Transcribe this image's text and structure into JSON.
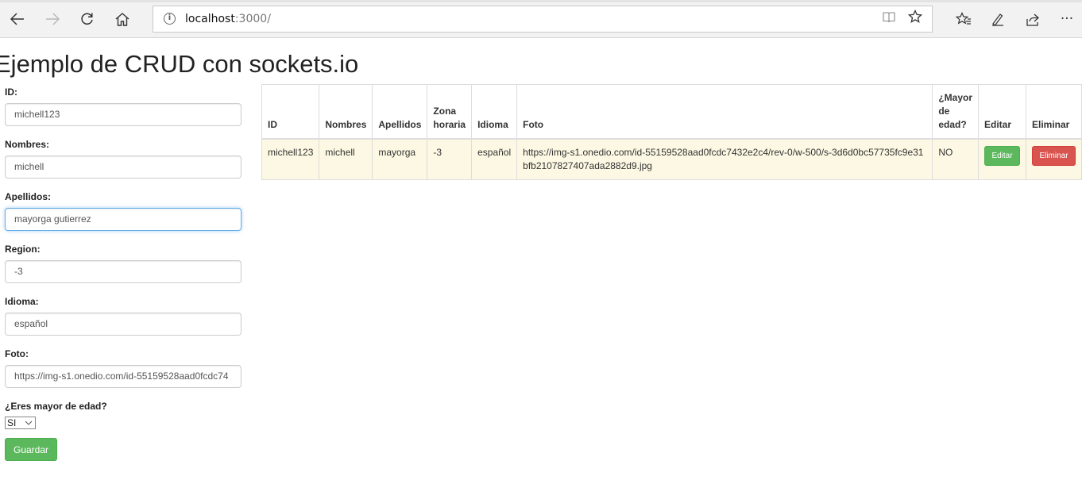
{
  "browser": {
    "url_host": "localhost",
    "url_path": ":3000/",
    "icons": {
      "back": "back-arrow-icon",
      "forward": "forward-arrow-icon",
      "refresh": "refresh-icon",
      "home": "home-icon",
      "info": "info-icon",
      "reading": "reading-view-icon",
      "favorite": "star-icon",
      "favorites_list": "favorites-list-icon",
      "pen": "pen-icon",
      "share": "share-icon",
      "more": "more-icon"
    }
  },
  "page": {
    "title": "Ejemplo de CRUD con sockets.io"
  },
  "form": {
    "id_label": "ID:",
    "id_value": "michell123",
    "nombres_label": "Nombres:",
    "nombres_value": "michell",
    "apellidos_label": "Apellidos:",
    "apellidos_value": "mayorga gutierrez",
    "region_label": "Region:",
    "region_value": "-3",
    "idioma_label": "Idioma:",
    "idioma_value": "español",
    "foto_label": "Foto:",
    "foto_value": "https://img-s1.onedio.com/id-55159528aad0fcdc74",
    "mayor_label": "¿Eres mayor de edad?",
    "mayor_value": "SI",
    "save_label": "Guardar"
  },
  "table": {
    "headers": {
      "id": "ID",
      "nombres": "Nombres",
      "apellidos": "Apellidos",
      "zona": "Zona horaria",
      "idioma": "Idioma",
      "foto": "Foto",
      "mayor": "¿Mayor de edad?",
      "editar": "Editar",
      "eliminar": "Eliminar"
    },
    "rows": [
      {
        "id": "michell123",
        "nombres": "michell",
        "apellidos": "mayorga",
        "zona": "-3",
        "idioma": "español",
        "foto": "https://img-s1.onedio.com/id-55159528aad0fcdc7432e2c4/rev-0/w-500/s-3d6d0bc57735fc9e31bfb2107827407ada2882d9.jpg",
        "mayor": "NO",
        "edit_label": "Editar",
        "delete_label": "Eliminar"
      }
    ]
  },
  "colors": {
    "success": "#5cb85c",
    "danger": "#d9534f",
    "row_highlight": "#fcf8e3"
  }
}
